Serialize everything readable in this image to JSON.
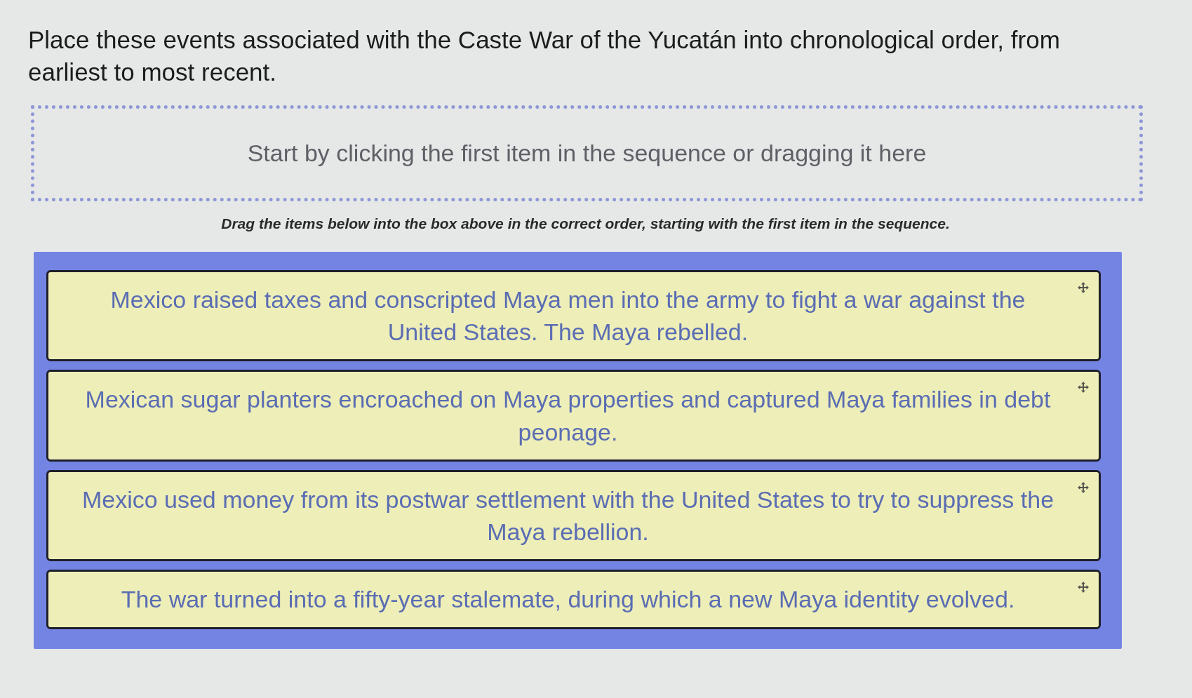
{
  "question": "Place these events associated with the Caste War of the Yucatán into chronological order, from earliest to most recent.",
  "drop_zone": {
    "prompt": "Start by clicking the first item in the sequence or dragging it here"
  },
  "instruction": "Drag the items below into the box above in the correct order, starting with the first item in the sequence.",
  "items": [
    {
      "text": "Mexico raised taxes and conscripted Maya men into the army to fight a war against the United States. The Maya rebelled."
    },
    {
      "text": "Mexican sugar planters encroached on Maya properties and captured Maya families in debt peonage."
    },
    {
      "text": "Mexico used money from its postwar settlement with the United States to try to suppress the Maya rebellion."
    },
    {
      "text": "The war turned into a fifty-year stalemate, during which a new Maya identity evolved."
    }
  ]
}
